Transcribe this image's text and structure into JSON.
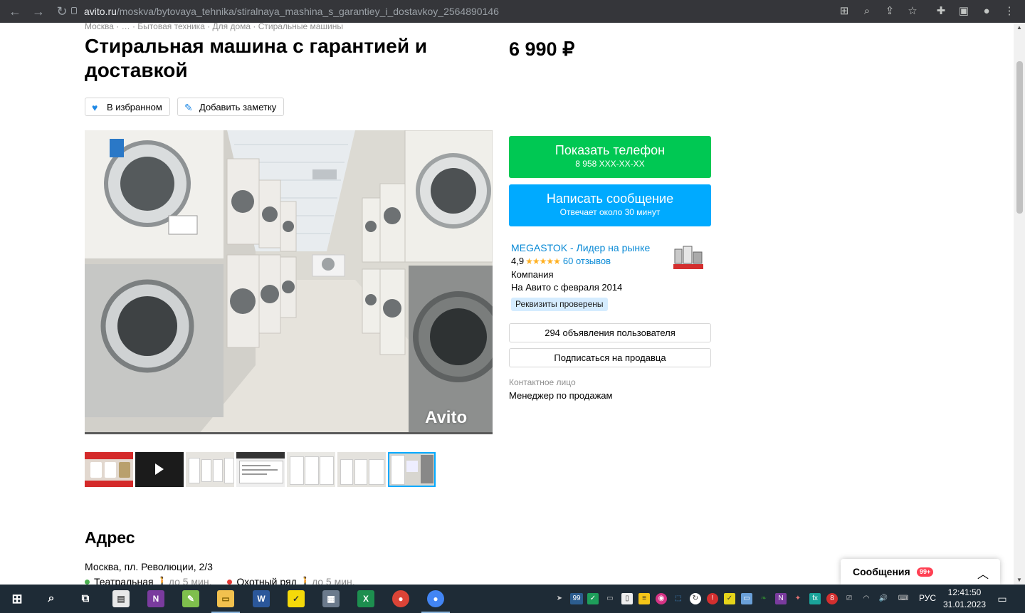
{
  "browser": {
    "url_host": "avito.ru",
    "url_path": "/moskva/bytovaya_tehnika/stiralnaya_mashina_s_garantiey_i_dostavkoy_2564890146"
  },
  "breadcrumbs": "Москва · … · Бытовая техника · Для дома · Стиральные машины",
  "listing": {
    "title": "Стиральная машина с гарантией и доставкой",
    "price": "6 990 ₽",
    "favorite_label": "В избранном",
    "note_label": "Добавить заметку"
  },
  "actions": {
    "show_phone": "Показать телефон",
    "phone_masked": "8 958 XXX-XX-XX",
    "write_message": "Написать сообщение",
    "reply_time": "Отвечает около 30 минут"
  },
  "seller": {
    "name": "MEGASTOK - Лидер на рынке",
    "rating": "4,9",
    "stars": "★★★★★",
    "reviews": "60 отзывов",
    "type": "Компания",
    "since": "На Авито с февраля 2014",
    "verified": "Реквизиты проверены",
    "listings_button": "294 объявления пользователя",
    "subscribe_button": "Подписаться на продавца",
    "contact_label": "Контактное лицо",
    "contact_name": "Менеджер по продажам"
  },
  "photo_watermark": "Avito",
  "thumbnails": [
    "photo-1",
    "video",
    "photo-3",
    "photo-4",
    "photo-5",
    "photo-6",
    "photo-7"
  ],
  "address": {
    "heading": "Адрес",
    "line": "Москва, пл. Революции, 2/3",
    "metro": [
      {
        "name": "Театральная",
        "walk": "до 5 мин.",
        "color": "#4caf50"
      },
      {
        "name": "Охотный ряд",
        "walk": "до 5 мин.",
        "color": "#e53935"
      }
    ]
  },
  "messenger": {
    "label": "Сообщения",
    "badge": "99+"
  },
  "taskbar": {
    "lang": "РУС",
    "time": "12:41:50",
    "date": "31.01.2023",
    "tray_count": "99"
  },
  "colors": {
    "green": "#00c853",
    "blue": "#00aaff",
    "link": "#0a8ad6"
  }
}
